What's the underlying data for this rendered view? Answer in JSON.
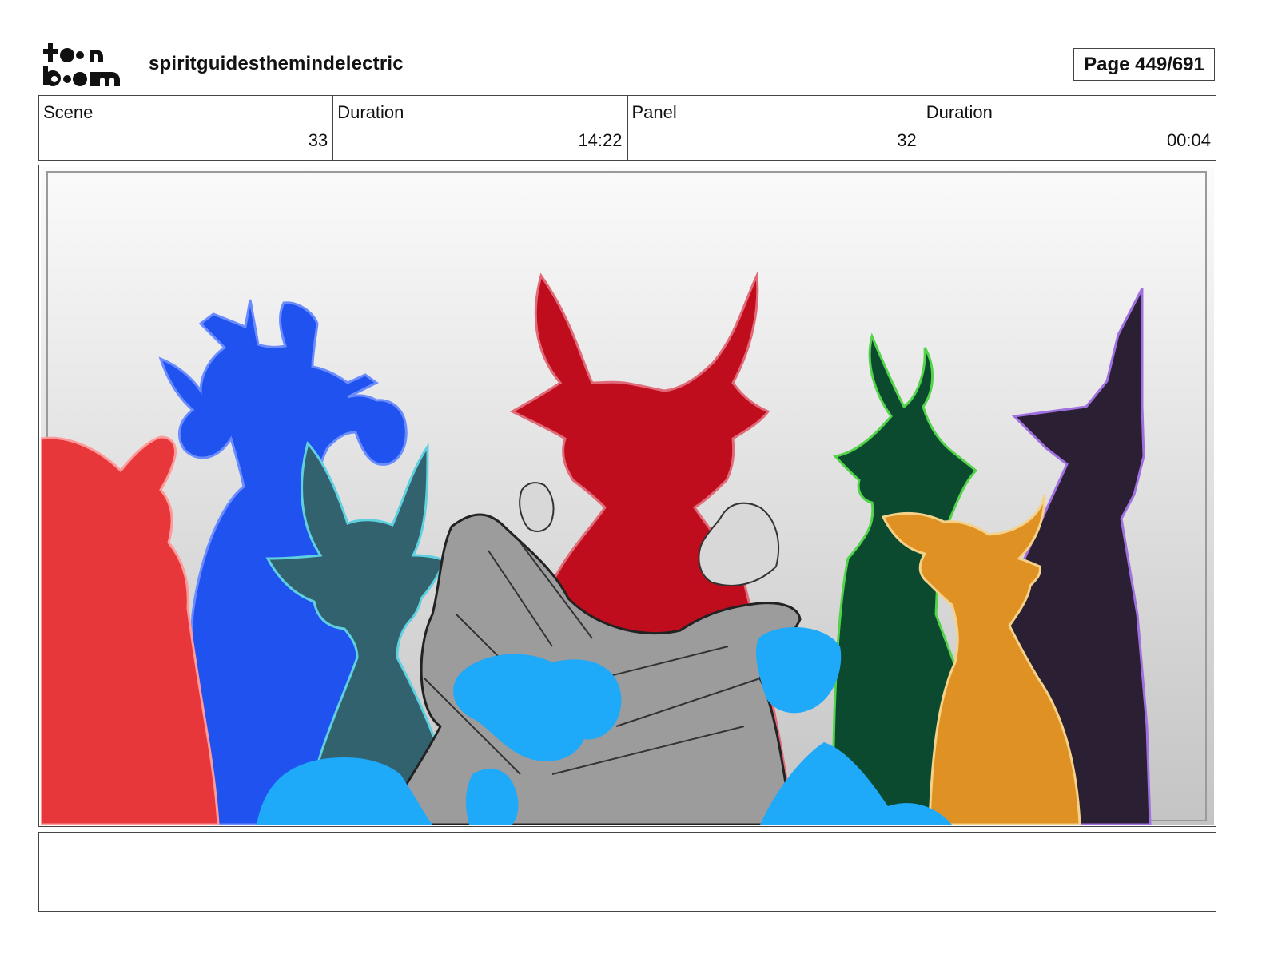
{
  "header": {
    "logo_line1": "toon",
    "logo_line2": "boom",
    "project_title": "spiritguidesthemindelectric",
    "page_label": "Page 449/691"
  },
  "info": {
    "scene_label": "Scene",
    "scene_value": "33",
    "scene_duration_label": "Duration",
    "scene_duration_value": "14:22",
    "panel_label": "Panel",
    "panel_value": "32",
    "panel_duration_label": "Duration",
    "panel_duration_value": "00:04"
  },
  "panel_image": {
    "colors": {
      "red_spirit": "#e8373a",
      "blue_spirit": "#2052ef",
      "teal_spirit": "#33626f",
      "crimson_demon": "#bf0d1d",
      "green_spirit": "#0b4a2f",
      "orange_spirit": "#e09123",
      "purple_spirit": "#2a1f33",
      "hands": "#9c9c9c",
      "water": "#1ea9f9"
    }
  },
  "notes": {
    "text": ""
  }
}
